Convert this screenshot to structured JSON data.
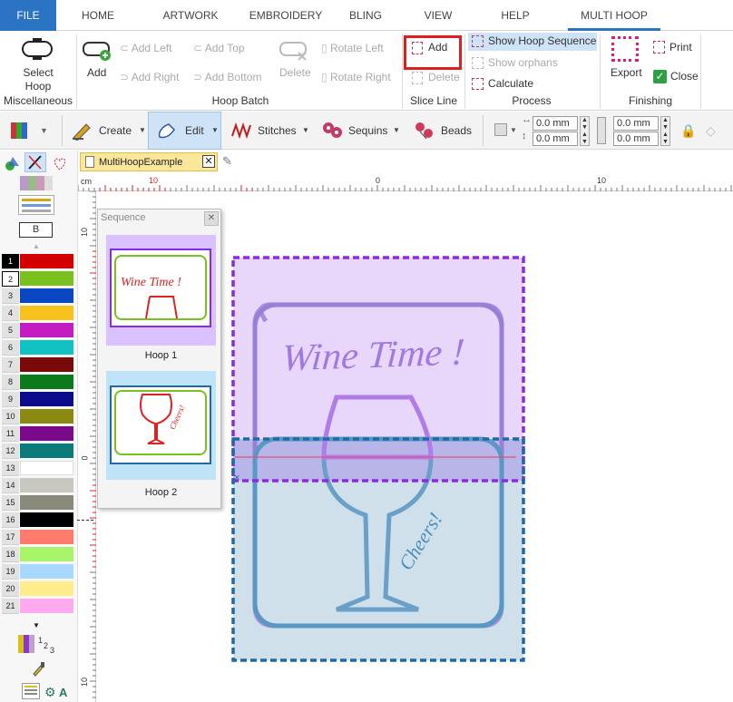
{
  "menu": {
    "tabs": [
      "FILE",
      "HOME",
      "ARTWORK",
      "EMBROIDERY",
      "BLING",
      "VIEW",
      "HELP",
      "MULTI HOOP"
    ]
  },
  "ribbon": {
    "select_hoop": "Select Hoop",
    "misc_group": "Miscellaneous",
    "add": "Add",
    "add_left": "Add Left",
    "add_top": "Add Top",
    "add_right": "Add Right",
    "add_bottom": "Add Bottom",
    "delete": "Delete",
    "rotate_left": "Rotate Left",
    "rotate_right": "Rotate Right",
    "hoop_batch_group": "Hoop Batch",
    "slice_add": "Add",
    "slice_delete": "Delete",
    "slice_group": "Slice Line",
    "show_hoop_sequence": "Show Hoop Sequence",
    "show_orphans": "Show orphans",
    "calculate": "Calculate",
    "process_group": "Process",
    "export": "Export",
    "print": "Print",
    "close": "Close",
    "finishing_group": "Finishing"
  },
  "toolbar": {
    "create": "Create",
    "edit": "Edit",
    "stitches": "Stitches",
    "sequins": "Sequins",
    "beads": "Beads",
    "x1": "0.0 mm",
    "y1": "0.0 mm",
    "x2": "0.0 mm",
    "y2": "0.0 mm"
  },
  "palette": {
    "b_label": "B",
    "colors": [
      {
        "n": "1",
        "c": "#d40000"
      },
      {
        "n": "2",
        "c": "#7ac01e"
      },
      {
        "n": "3",
        "c": "#0a47c2"
      },
      {
        "n": "4",
        "c": "#f7c21c"
      },
      {
        "n": "5",
        "c": "#c21cc2"
      },
      {
        "n": "6",
        "c": "#10c2c2"
      },
      {
        "n": "7",
        "c": "#7a0a0a"
      },
      {
        "n": "8",
        "c": "#0a7a1a"
      },
      {
        "n": "9",
        "c": "#0a0a8a"
      },
      {
        "n": "10",
        "c": "#8a8a12"
      },
      {
        "n": "11",
        "c": "#7a0a8a"
      },
      {
        "n": "12",
        "c": "#0a7a7a"
      },
      {
        "n": "13",
        "c": "#ffffff"
      },
      {
        "n": "14",
        "c": "#c8c8c0"
      },
      {
        "n": "15",
        "c": "#8a8a7a"
      },
      {
        "n": "16",
        "c": "#000000"
      },
      {
        "n": "17",
        "c": "#ff7a6a"
      },
      {
        "n": "18",
        "c": "#a8f56a"
      },
      {
        "n": "19",
        "c": "#a8d8ff"
      },
      {
        "n": "20",
        "c": "#ffec8a"
      },
      {
        "n": "21",
        "c": "#ffaaee"
      }
    ],
    "order_label_1": "1",
    "order_label_2": "2",
    "order_label_3": "3"
  },
  "document": {
    "tab_name": "MultiHoopExample"
  },
  "ruler": {
    "unit": "cm",
    "h_labels": [
      "10",
      "0",
      "10"
    ],
    "v_labels": [
      "10",
      "0",
      "10"
    ]
  },
  "sequence": {
    "title": "Sequence",
    "hoop1": "Hoop 1",
    "hoop2": "Hoop 2",
    "thumb1_text": "Wine Time !",
    "thumb2_text": "Cheers!"
  },
  "design": {
    "title_text": "Wine Time !",
    "cheers_text": "Cheers!",
    "hoop1_color": "#9b3ff0",
    "hoop2_color": "#1f6aa5",
    "accent": "#2b73c3"
  }
}
